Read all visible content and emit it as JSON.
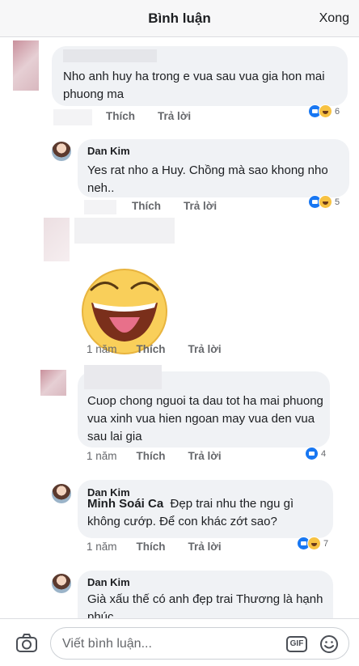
{
  "header": {
    "title": "Bình luận",
    "done": "Xong"
  },
  "comments": [
    {
      "name": "",
      "text": "Nho anh huy ha trong e vua sau vua gia hon mai phuong ma",
      "time": "",
      "like": "Thích",
      "reply": "Trả lời",
      "reactions": [
        "like-icon",
        "haha-icon"
      ],
      "reaction_count": "6"
    },
    {
      "name": "Dan Kim",
      "text": "Yes rat nho a Huy. Chồng mà sao khong nho neh..",
      "time": "",
      "like": "Thích",
      "reply": "Trả lời",
      "reactions": [
        "like-icon",
        "haha-icon"
      ],
      "reaction_count": "5"
    },
    {
      "name": "",
      "text": "",
      "sticker": "tongue-out-sticker",
      "time": "1 năm",
      "like": "Thích",
      "reply": "Trả lời"
    },
    {
      "name": "",
      "text": "Cuop chong nguoi ta dau tot ha mai phuong vua xinh vua hien ngoan may vua den vua sau lai gia",
      "time": "1 năm",
      "like": "Thích",
      "reply": "Trả lời",
      "reactions": [
        "like-icon"
      ],
      "reaction_count": "4"
    },
    {
      "name": "Dan Kim",
      "mention": "Minh Soái Ca",
      "text": "Đẹp trai nhu the ngu gì không cướp. Để con khác zớt sao?",
      "time": "1 năm",
      "like": "Thích",
      "reply": "Trả lời",
      "reactions": [
        "like-icon",
        "haha-icon"
      ],
      "reaction_count": "7"
    },
    {
      "name": "Dan Kim",
      "text": "Già xấu thế có anh đẹp trai Thương là hạnh phúc."
    }
  ],
  "composer": {
    "placeholder": "Viết bình luận...",
    "gif": "GIF"
  },
  "colors": {
    "accent": "#1877f2",
    "bubble": "#f0f2f5",
    "meta": "#65676b"
  }
}
